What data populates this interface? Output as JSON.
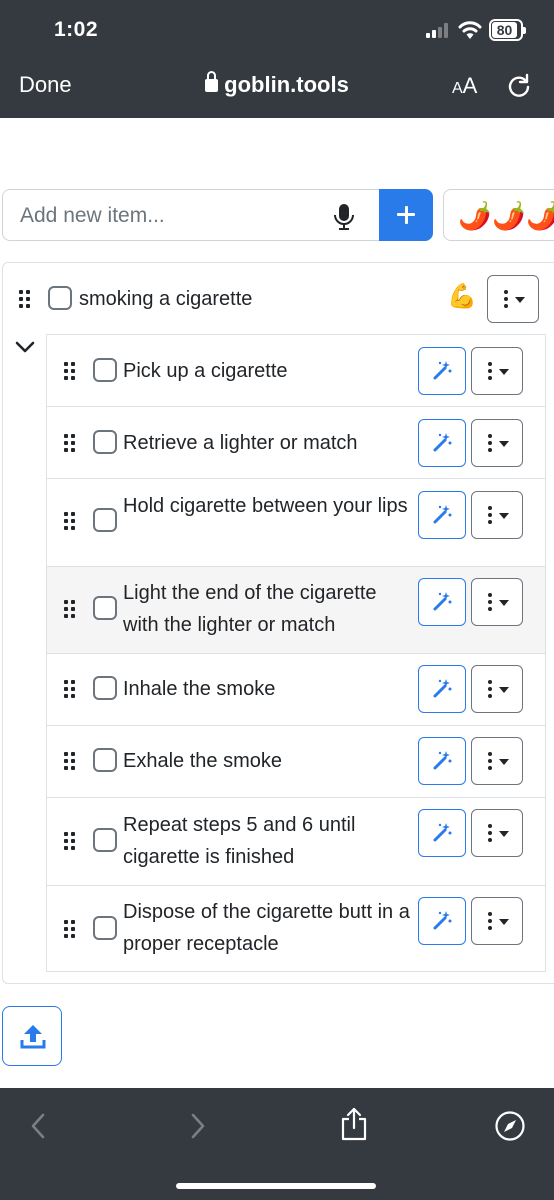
{
  "status_bar": {
    "time": "1:02",
    "battery": "80"
  },
  "browser": {
    "done_label": "Done",
    "url": "goblin.tools",
    "aa_label_small": "A",
    "aa_label_large": "A"
  },
  "add_row": {
    "placeholder": "Add new item...",
    "spiciness": [
      "🌶️",
      "🌶️",
      "🌶️"
    ]
  },
  "task": {
    "title": "smoking a cigarette",
    "badge_emoji": "💪",
    "subtasks": [
      {
        "text": "Pick up a cigarette"
      },
      {
        "text": "Retrieve a lighter or match"
      },
      {
        "text": "Hold cigarette between your lips"
      },
      {
        "text": "Light the end of the cigarette with the lighter or match"
      },
      {
        "text": "Inhale the smoke"
      },
      {
        "text": "Exhale the smoke"
      },
      {
        "text": "Repeat steps 5 and 6 until cigarette is finished"
      },
      {
        "text": "Dispose of the cigarette butt in a proper receptacle"
      }
    ]
  },
  "colors": {
    "accent": "#2a7bea",
    "bar": "#353a40",
    "border": "#dee2e6",
    "highlight_row": "#f5f5f5"
  },
  "icons": [
    "lock-icon",
    "mic-icon",
    "plus-icon",
    "chili-icon",
    "drag-handle-icon",
    "magic-wand-icon",
    "kebab-menu-icon",
    "chevron-down-icon",
    "upload-icon",
    "back-icon",
    "forward-icon",
    "share-icon",
    "compass-icon",
    "reload-icon",
    "wifi-icon",
    "signal-icon",
    "battery-icon",
    "muscle-icon"
  ]
}
